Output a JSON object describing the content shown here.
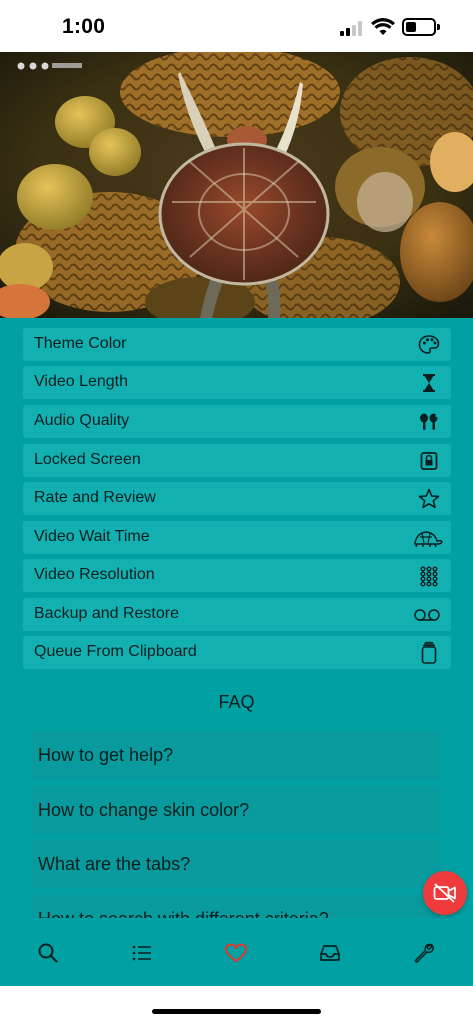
{
  "status_bar": {
    "time": "1:00"
  },
  "settings": [
    {
      "label": "Theme Color",
      "icon": "palette-icon"
    },
    {
      "label": "Video Length",
      "icon": "hourglass-icon"
    },
    {
      "label": "Audio Quality",
      "icon": "earbuds-icon"
    },
    {
      "label": "Locked Screen",
      "icon": "lock-icon"
    },
    {
      "label": "Rate and Review",
      "icon": "star-icon"
    },
    {
      "label": "Video Wait Time",
      "icon": "tortoise-icon"
    },
    {
      "label": "Video Resolution",
      "icon": "grid-dots-icon"
    },
    {
      "label": "Backup and Restore",
      "icon": "voicemail-icon"
    },
    {
      "label": "Queue From Clipboard",
      "icon": "clipboard-icon"
    }
  ],
  "faq": {
    "title": "FAQ",
    "items": [
      "How to get help?",
      "How to change skin color?",
      "What are the tabs?",
      "How to search with different criteria?"
    ]
  },
  "tabbar": {
    "tabs": [
      "search-icon",
      "list-icon",
      "heart-icon",
      "inbox-icon",
      "wrench-icon"
    ],
    "active_color": "#e8332f"
  },
  "colors": {
    "accent": "#00a0a3",
    "row": "#13b0b2",
    "faq_row": "#089a9c",
    "fab": "#ef3b3b"
  }
}
